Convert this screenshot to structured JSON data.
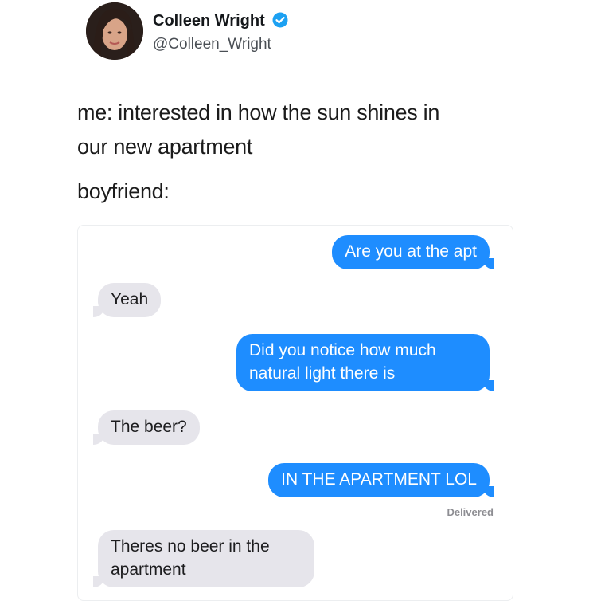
{
  "tweet": {
    "display_name": "Colleen Wright",
    "handle": "@Colleen_Wright",
    "verified_icon": "verified-badge-icon",
    "text_line1": "me: interested in how the sun shines in",
    "text_line2": "our new apartment",
    "text_line3": "boyfriend:"
  },
  "chat": {
    "messages": [
      {
        "from": "me",
        "text": "Are you at the apt"
      },
      {
        "from": "them",
        "text": "Yeah"
      },
      {
        "from": "me",
        "text": "Did you notice how much natural light there is"
      },
      {
        "from": "them",
        "text": "The beer?"
      },
      {
        "from": "me",
        "text": "IN THE APARTMENT LOL"
      },
      {
        "from": "them",
        "text": "Theres no beer in the apartment"
      }
    ],
    "delivered_label": "Delivered"
  },
  "colors": {
    "outgoing_bubble": "#1e8dff",
    "incoming_bubble": "#e6e5eb",
    "verified": "#1da1f2"
  }
}
